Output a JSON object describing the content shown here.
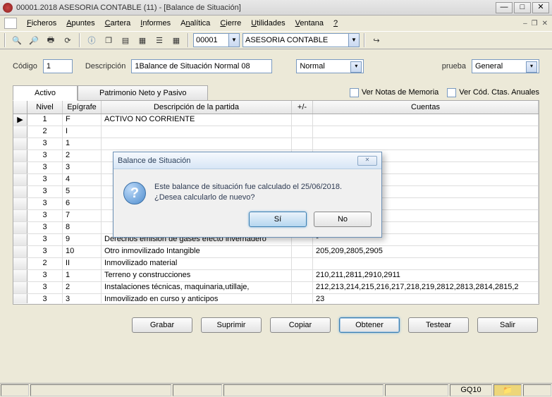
{
  "window": {
    "title": "00001.2018 ASESORIA CONTABLE (11) - [Balance de Situación]"
  },
  "menu": {
    "m0": "Ficheros",
    "m1": "Apuntes",
    "m2": "Cartera",
    "m3": "Informes",
    "m4": "Analítica",
    "m5": "Cierre",
    "m6": "Utilidades",
    "m7": "Ventana",
    "m8": "?"
  },
  "toolbar": {
    "code": "00001",
    "name": "ASESORIA CONTABLE"
  },
  "form": {
    "codigo_label": "Código",
    "codigo_value": "1",
    "desc_label": "Descripción",
    "desc_value": "1Balance de Situación Normal 08",
    "tipo": "Normal",
    "prueba_label": "prueba",
    "prueba_value": "General"
  },
  "tabs": {
    "t0": "Activo",
    "t1": "Patrimonio Neto y Pasivo"
  },
  "checks": {
    "c0": "Ver Notas de Memoria",
    "c1": "Ver Cód. Ctas. Anuales"
  },
  "gridhead": {
    "h0": "Nivel",
    "h1": "Epígrafe",
    "h2": "Descripción de la partida",
    "h3": "+/-",
    "h4": "Cuentas"
  },
  "rows": [
    {
      "n": "1",
      "e": "F",
      "d": "ACTIVO NO CORRIENTE",
      "p": "",
      "c": ""
    },
    {
      "n": "2",
      "e": "I",
      "d": "",
      "p": "",
      "c": ""
    },
    {
      "n": "3",
      "e": "1",
      "d": "",
      "p": "",
      "c": ""
    },
    {
      "n": "3",
      "e": "2",
      "d": "",
      "p": "",
      "c": ""
    },
    {
      "n": "3",
      "e": "3",
      "d": "",
      "p": "",
      "c": ""
    },
    {
      "n": "3",
      "e": "4",
      "d": "",
      "p": "",
      "c": ""
    },
    {
      "n": "3",
      "e": "5",
      "d": "",
      "p": "",
      "c": ""
    },
    {
      "n": "3",
      "e": "6",
      "d": "",
      "p": "",
      "c": ""
    },
    {
      "n": "3",
      "e": "7",
      "d": "",
      "p": "",
      "c": ""
    },
    {
      "n": "3",
      "e": "8",
      "d": "",
      "p": "",
      "c": ""
    },
    {
      "n": "3",
      "e": "9",
      "d": "Derechos emisión de gases efecto invernadero",
      "p": "",
      "c": "*"
    },
    {
      "n": "3",
      "e": "10",
      "d": "Otro inmovilizado Intangible",
      "p": "",
      "c": "205,209,2805,2905"
    },
    {
      "n": "2",
      "e": "II",
      "d": "Inmovilizado material",
      "p": "",
      "c": ""
    },
    {
      "n": "3",
      "e": "1",
      "d": "Terreno y construcciones",
      "p": "",
      "c": "210,211,2811,2910,2911"
    },
    {
      "n": "3",
      "e": "2",
      "d": "Instalaciones técnicas, maquinaria,utillaje,",
      "p": "",
      "c": "212,213,214,215,216,217,218,219,2812,2813,2814,2815,2"
    },
    {
      "n": "3",
      "e": "3",
      "d": "Inmovilizado en curso y anticipos",
      "p": "",
      "c": "23"
    }
  ],
  "buttons": {
    "b0": "Grabar",
    "b1": "Suprimir",
    "b2": "Copiar",
    "b3": "Obtener",
    "b4": "Testear",
    "b5": "Salir"
  },
  "status": {
    "code": "GQ10"
  },
  "dialog": {
    "title": "Balance de Situación",
    "line1": "Este balance de situación fue calculado el 25/06/2018.",
    "line2": "¿Desea calcularlo de nuevo?",
    "yes": "Sí",
    "no": "No"
  }
}
